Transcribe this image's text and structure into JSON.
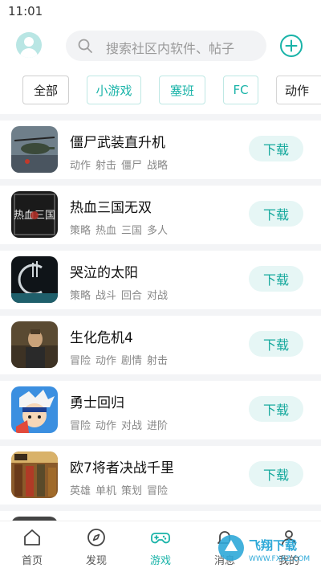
{
  "status": {
    "time": "11:01"
  },
  "search": {
    "placeholder": "搜索社区内软件、帖子"
  },
  "categories": [
    "全部",
    "小游戏",
    "塞班",
    "FC",
    "动作"
  ],
  "games": [
    {
      "title": "僵尸武装直升机",
      "tags": [
        "动作",
        "射击",
        "僵尸",
        "战略"
      ],
      "button": "下载"
    },
    {
      "title": "热血三国无双",
      "tags": [
        "策略",
        "热血",
        "三国",
        "多人"
      ],
      "button": "下载"
    },
    {
      "title": "哭泣的太阳",
      "tags": [
        "策略",
        "战斗",
        "回合",
        "对战"
      ],
      "button": "下载"
    },
    {
      "title": "生化危机4",
      "tags": [
        "冒险",
        "动作",
        "剧情",
        "射击"
      ],
      "button": "下载"
    },
    {
      "title": "勇士回归",
      "tags": [
        "冒险",
        "动作",
        "对战",
        "进阶"
      ],
      "button": "下载"
    },
    {
      "title": "欧7将者决战千里",
      "tags": [
        "英雄",
        "单机",
        "策划",
        "冒险"
      ],
      "button": "下载"
    }
  ],
  "tabs": [
    {
      "label": "首页",
      "icon": "home-icon"
    },
    {
      "label": "发现",
      "icon": "compass-icon"
    },
    {
      "label": "游戏",
      "icon": "gamepad-icon",
      "active": true
    },
    {
      "label": "消息",
      "icon": "bell-icon"
    },
    {
      "label": "我的",
      "icon": "user-icon"
    }
  ],
  "thumb_text": {
    "game2": "热血三国"
  },
  "watermark": {
    "text": "飞翔下载",
    "url": "WWW.FXXZ.COM"
  },
  "colors": {
    "accent": "#19b3a8",
    "download_bg": "#e6f6f5",
    "search_bg": "#f2f3f5"
  }
}
